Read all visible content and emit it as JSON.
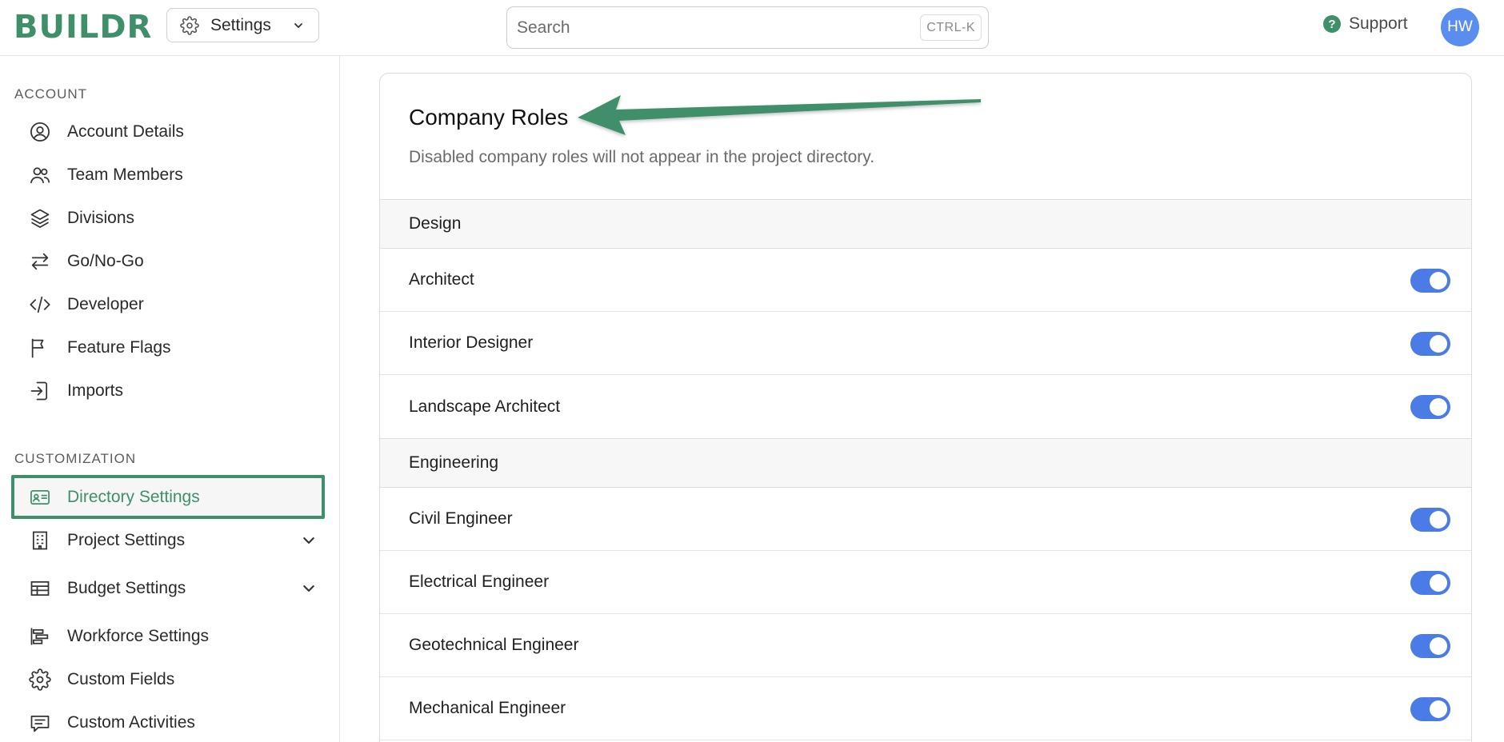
{
  "app": {
    "logo": "BUILDR"
  },
  "header": {
    "settings_label": "Settings",
    "search_placeholder": "Search",
    "search_shortcut": "CTRL-K",
    "support_label": "Support",
    "avatar_initials": "HW"
  },
  "sidebar": {
    "account_title": "ACCOUNT",
    "account_items": [
      {
        "label": "Account Details",
        "icon": "user-circle-icon"
      },
      {
        "label": "Team Members",
        "icon": "users-icon"
      },
      {
        "label": "Divisions",
        "icon": "layers-icon"
      },
      {
        "label": "Go/No-Go",
        "icon": "arrows-left-right-icon"
      },
      {
        "label": "Developer",
        "icon": "code-icon"
      },
      {
        "label": "Feature Flags",
        "icon": "flag-icon"
      },
      {
        "label": "Imports",
        "icon": "import-icon"
      }
    ],
    "customization_title": "CUSTOMIZATION",
    "customization_items": [
      {
        "label": "Directory Settings",
        "icon": "id-card-icon",
        "active": true
      },
      {
        "label": "Project Settings",
        "icon": "building-icon",
        "expandable": true
      },
      {
        "label": "Budget Settings",
        "icon": "table-icon",
        "expandable": true
      },
      {
        "label": "Workforce Settings",
        "icon": "gantt-icon"
      },
      {
        "label": "Custom Fields",
        "icon": "gear-icon"
      },
      {
        "label": "Custom Activities",
        "icon": "message-icon"
      }
    ]
  },
  "main": {
    "title": "Company Roles",
    "description": "Disabled company roles will not appear in the project directory.",
    "groups": [
      {
        "name": "Design",
        "roles": [
          {
            "label": "Architect",
            "enabled": true
          },
          {
            "label": "Interior Designer",
            "enabled": true
          },
          {
            "label": "Landscape Architect",
            "enabled": true
          }
        ]
      },
      {
        "name": "Engineering",
        "roles": [
          {
            "label": "Civil Engineer",
            "enabled": true
          },
          {
            "label": "Electrical Engineer",
            "enabled": true
          },
          {
            "label": "Geotechnical Engineer",
            "enabled": true
          },
          {
            "label": "Mechanical Engineer",
            "enabled": true
          }
        ]
      }
    ]
  },
  "colors": {
    "brand": "#3f8f6b",
    "toggle_on": "#4a7be6",
    "avatar": "#5b8def"
  }
}
